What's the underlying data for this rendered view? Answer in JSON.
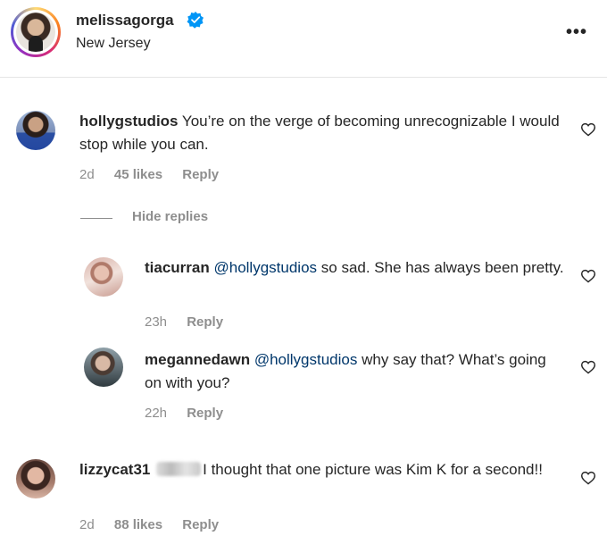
{
  "header": {
    "username": "melissagorga",
    "location": "New Jersey",
    "more_label": "•••"
  },
  "comments": [
    {
      "username": "hollygstudios",
      "text": "You’re on the verge of becoming unrecognizable I would stop while you can.",
      "time": "2d",
      "likes": "45 likes",
      "reply": "Reply"
    },
    {
      "username": "lizzycat31",
      "text": "I thought that one picture was Kim K for a second!!",
      "time": "2d",
      "likes": "88 likes",
      "reply": "Reply"
    }
  ],
  "hide_replies_label": "Hide replies",
  "replies": [
    {
      "username": "tiacurran",
      "mention": "@hollygstudios",
      "text": "so sad. She has always been pretty.",
      "time": "23h",
      "reply": "Reply"
    },
    {
      "username": "megannedawn",
      "mention": "@hollygstudios",
      "text": "why say that? What’s going on with you?",
      "time": "22h",
      "reply": "Reply"
    }
  ],
  "colors": {
    "mention": "#00376b",
    "verified": "#0095f6",
    "meta": "#8e8e8e"
  }
}
